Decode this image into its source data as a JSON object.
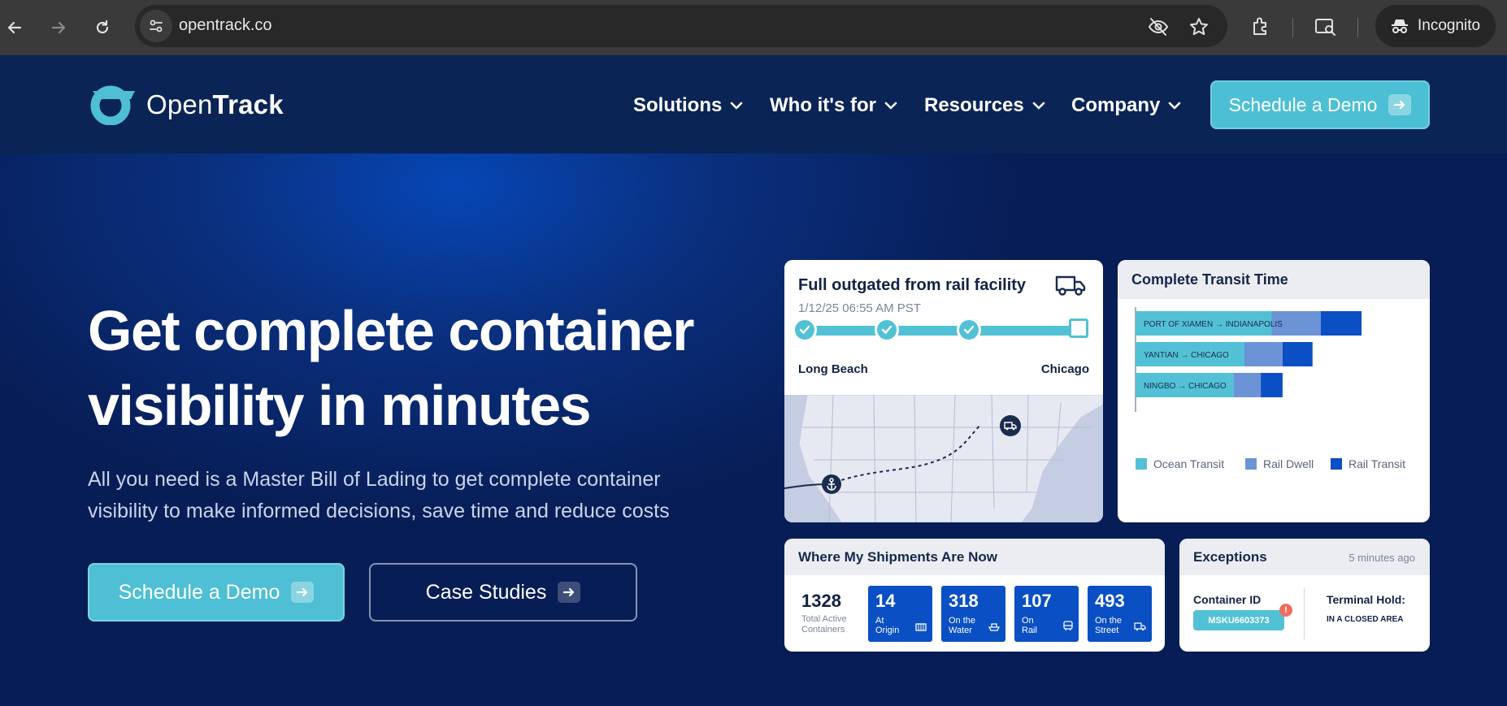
{
  "browser": {
    "url": "opentrack.co",
    "profile_label": "Incognito"
  },
  "header": {
    "logo_main": "Open",
    "logo_bold": "Track",
    "nav": [
      {
        "label": "Solutions"
      },
      {
        "label": "Who it's for"
      },
      {
        "label": "Resources"
      },
      {
        "label": "Company"
      }
    ],
    "cta_label": "Schedule a Demo"
  },
  "hero": {
    "title_line1": "Get complete container",
    "title_line2": "visibility in minutes",
    "subtitle_line1": "All you need is a Master Bill of Lading to get complete container",
    "subtitle_line2": "visibility to make informed decisions, save time and reduce costs",
    "primary_label": "Schedule a Demo",
    "secondary_label": "Case Studies"
  },
  "status_card": {
    "title": "Full outgated from rail facility",
    "timestamp": "1/12/25 06:55 AM PST",
    "origin": "Long Beach",
    "destination": "Chicago"
  },
  "transit_card": {
    "title": "Complete Transit Time",
    "chart_data": {
      "type": "bar",
      "orientation": "horizontal",
      "stacked": true,
      "categories": [
        "PORT OF XIAMEN → INDIANAPOLIS",
        "YANTIAN → CHICAGO",
        "NINGBO → CHICAGO"
      ],
      "series": [
        {
          "name": "Ocean Transit",
          "values": [
            50,
            40,
            36
          ]
        },
        {
          "name": "Rail Dwell",
          "values": [
            18,
            14,
            10
          ]
        },
        {
          "name": "Rail Transit",
          "values": [
            15,
            11,
            8
          ]
        }
      ],
      "colors": [
        "#52c1d5",
        "#6b93d6",
        "#0a4fc3"
      ],
      "grid": false,
      "legend": "bottom"
    }
  },
  "shipments_card": {
    "title": "Where My Shipments Are Now",
    "total": {
      "value": "1328",
      "label_line1": "Total Active",
      "label_line2": "Containers"
    },
    "stats": [
      {
        "value": "14",
        "line1": "At",
        "line2": "Origin",
        "icon": "container-icon"
      },
      {
        "value": "318",
        "line1": "On the",
        "line2": "Water",
        "icon": "ship-icon"
      },
      {
        "value": "107",
        "line1": "On",
        "line2": "Rail",
        "icon": "train-icon"
      },
      {
        "value": "493",
        "line1": "On the",
        "line2": "Street",
        "icon": "truck-icon"
      }
    ]
  },
  "exceptions_card": {
    "title": "Exceptions",
    "time_ago": "5 minutes ago",
    "container_label": "Container ID",
    "container_id": "MSKU6603373",
    "alert_mark": "!",
    "hold_label": "Terminal Hold:",
    "hold_value": "IN A CLOSED AREA"
  }
}
